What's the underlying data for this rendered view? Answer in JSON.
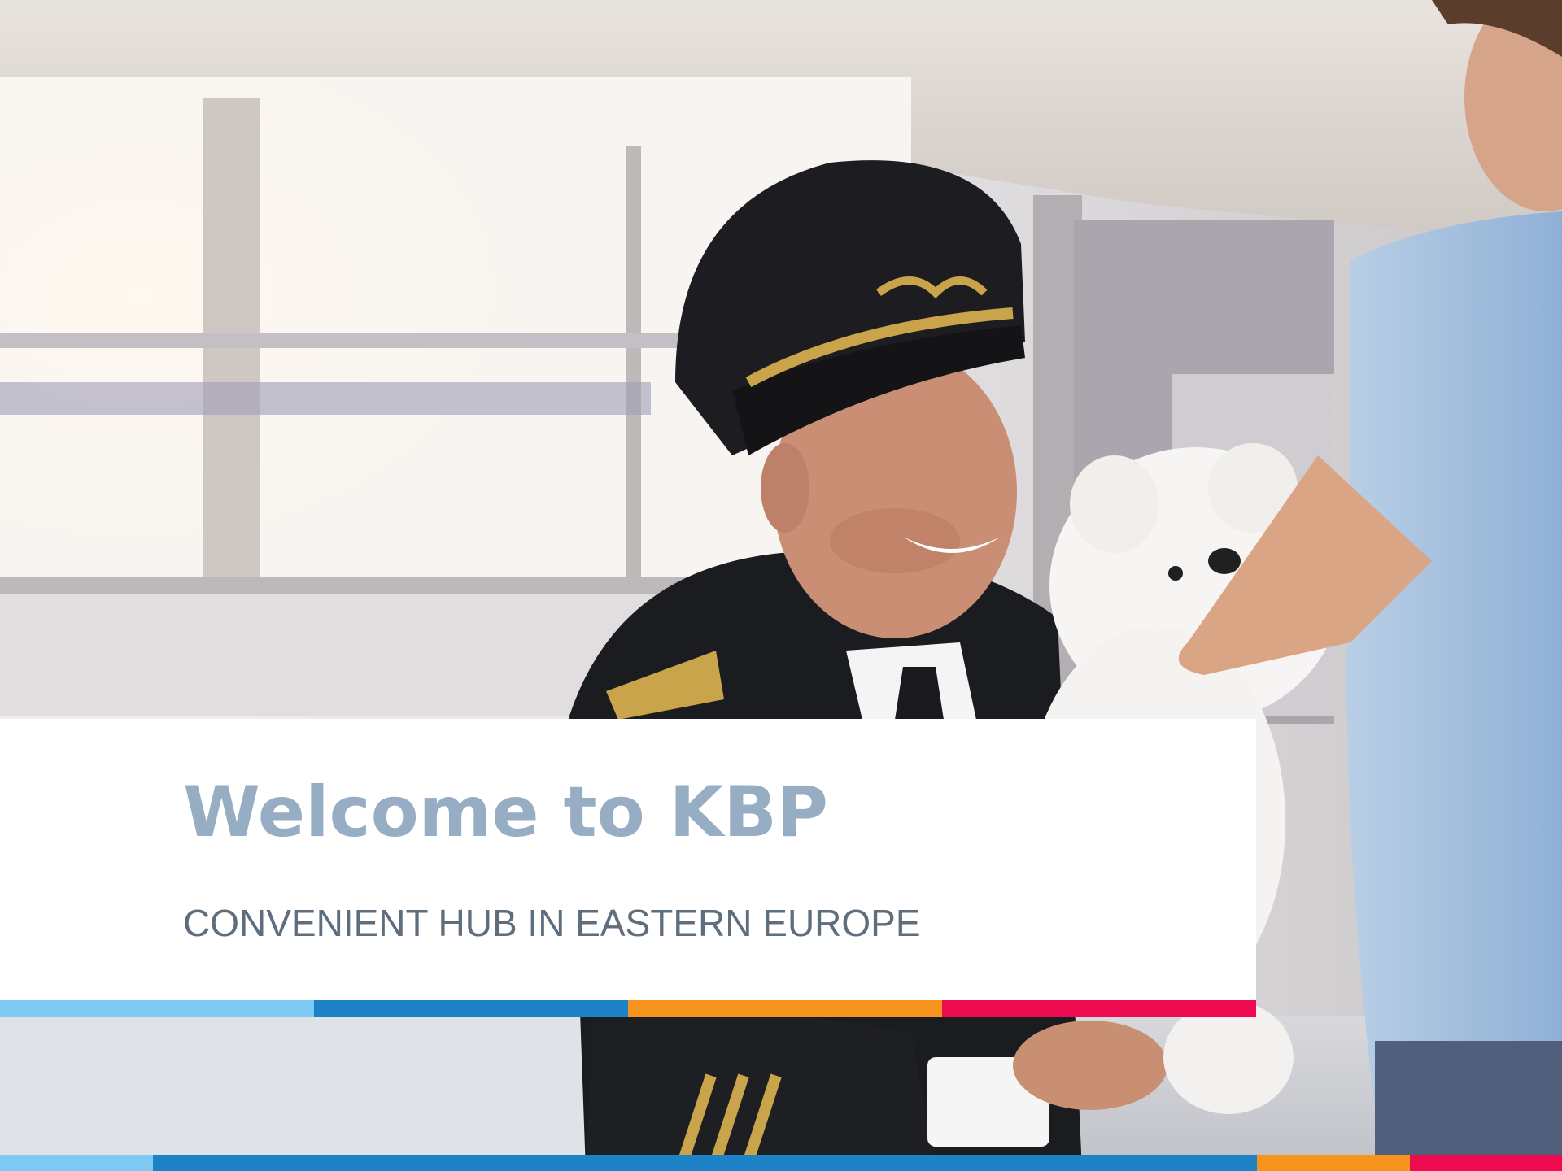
{
  "slide": {
    "headline": "Welcome to KBP",
    "subheadline": "CONVENIENT HUB IN EASTERN EUROPE"
  },
  "colors": {
    "headline": "#97adc4",
    "subheadline": "#5f6e7d",
    "card": "#ffffff",
    "stripe_light_blue": "#7fcaf5",
    "stripe_blue": "#1e82c6",
    "stripe_orange": "#f7941d",
    "stripe_pink": "#ed0a4f"
  },
  "background_photo": {
    "subject": "pilot-receiving-teddy-bear-from-child-photo"
  }
}
